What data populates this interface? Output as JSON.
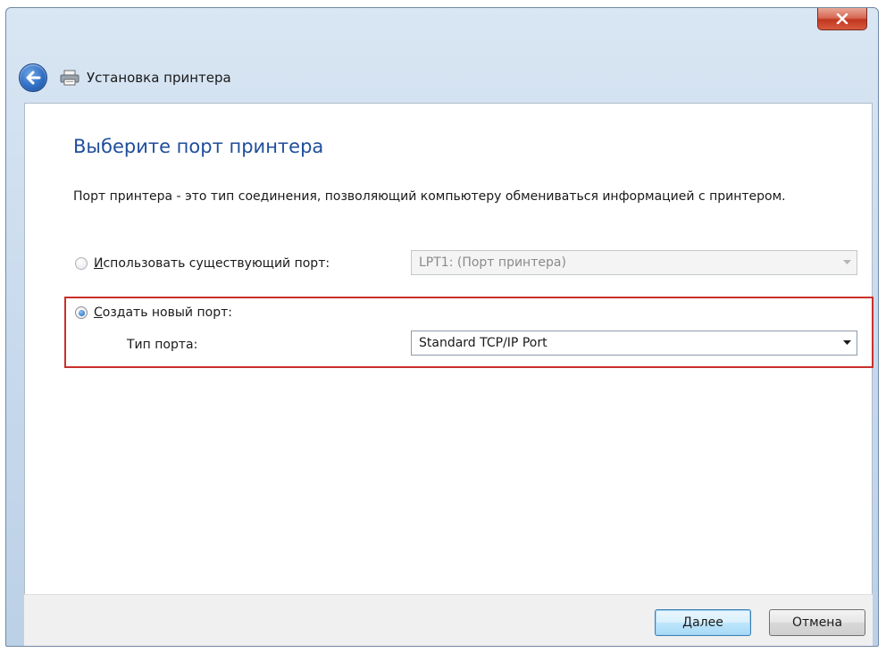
{
  "window": {
    "title": "Установка принтера",
    "close_label": "x"
  },
  "content": {
    "heading": "Выберите порт принтера",
    "description": "Порт принтера - это тип соединения, позволяющий компьютеру обмениваться информацией с принтером."
  },
  "options": {
    "existing_port": {
      "label_accel": "И",
      "label_rest": "спользовать существующий порт:",
      "selected": false,
      "enabled": false,
      "value": "LPT1: (Порт принтера)"
    },
    "new_port": {
      "label_accel": "С",
      "label_rest": "оздать новый порт:",
      "selected": true,
      "port_type_label": "Тип порта:",
      "port_type_value": "Standard TCP/IP Port"
    }
  },
  "footer": {
    "next_accel": "Д",
    "next_rest": "алее",
    "cancel_label": "Отмена"
  },
  "colors": {
    "heading": "#1f4e9c",
    "highlight_border": "#c9302c"
  },
  "icons": {
    "back": "back-arrow-icon",
    "printer": "printer-icon",
    "close": "close-icon",
    "dropdown": "chevron-down-icon"
  }
}
